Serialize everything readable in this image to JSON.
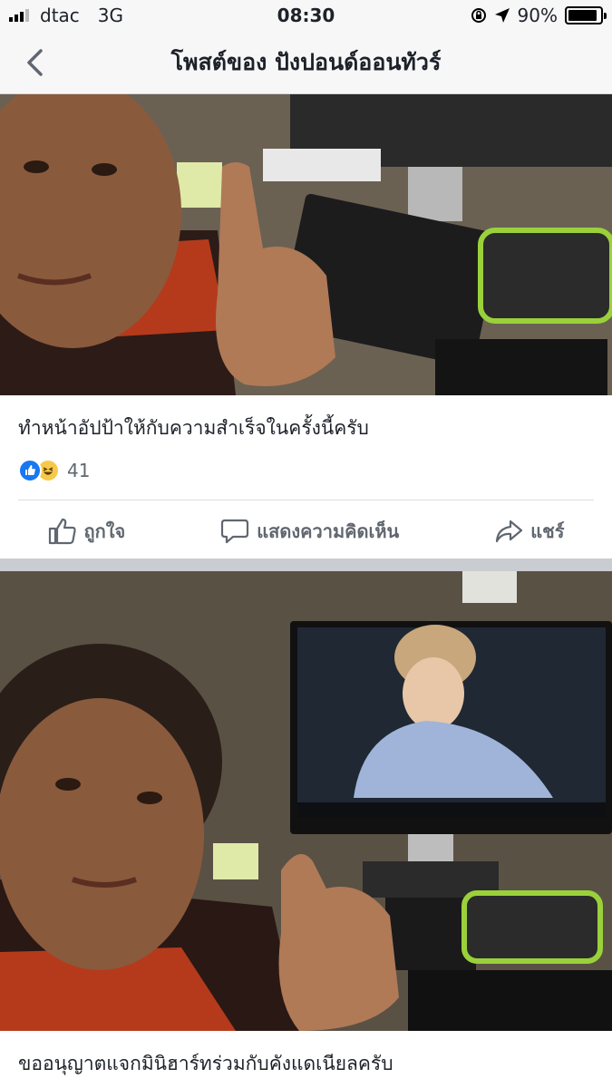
{
  "status_bar": {
    "carrier": "dtac",
    "network": "3G",
    "time": "08:30",
    "battery_percent": "90%",
    "battery_level": 0.9
  },
  "nav": {
    "back_icon": "chevron-left-icon",
    "title": "โพสต์ของ ปังปอนด์ออนทัวร์"
  },
  "posts": [
    {
      "caption": "ทำหน้าอัปป้าให้กับความสำเร็จในครั้งนี้ครับ",
      "reaction_count": "41",
      "reaction_icons": [
        "like-icon",
        "haha-icon"
      ],
      "actions": {
        "like": "ถูกใจ",
        "comment": "แสดงความคิดเห็น",
        "share": "แชร์"
      }
    },
    {
      "caption": "ขออนุญาตแจกมินิฮาร์ทร่วมกับคังแดเนียลครับ"
    }
  ],
  "colors": {
    "like_blue": "#1877f2",
    "haha_yellow": "#f7c94a",
    "text_gray": "#606770",
    "bg": "#e9ebee"
  }
}
